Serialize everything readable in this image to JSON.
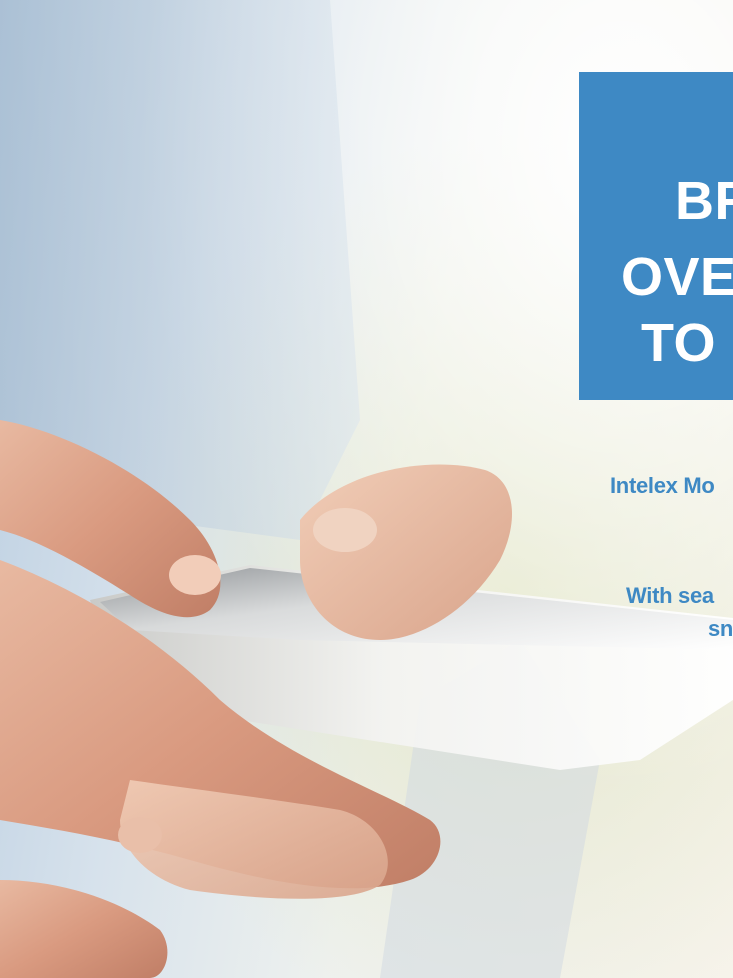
{
  "hero": {
    "lines": [
      "BR",
      "OVE",
      "TO"
    ],
    "background_color": "#3e89c4"
  },
  "body_text": {
    "line1": "Intelex Mo",
    "line2": "With sea",
    "line3": "sn",
    "color": "#3e89c4"
  },
  "photo": {
    "subject": "hands-holding-smartphone"
  }
}
